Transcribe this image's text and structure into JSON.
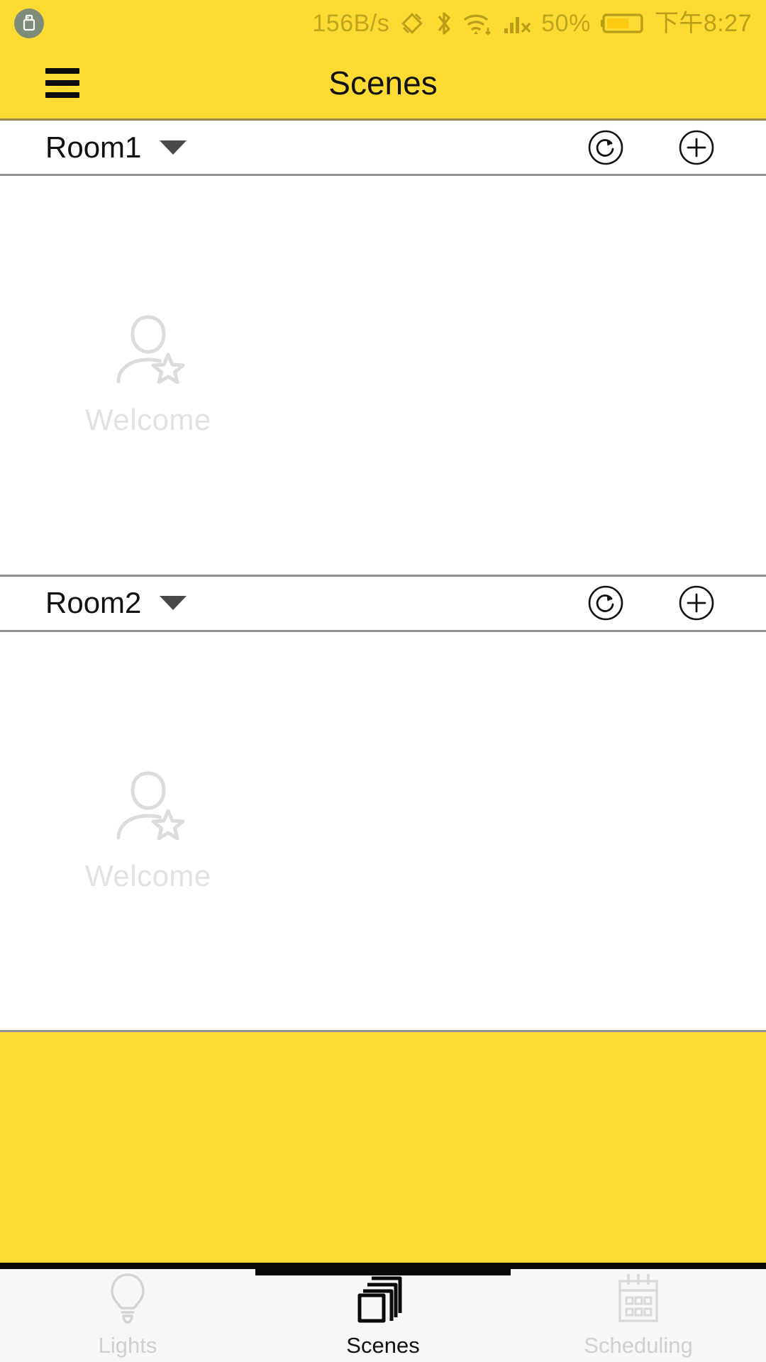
{
  "status_bar": {
    "left_icon": "usb-icon",
    "network_speed": "156B/s",
    "icons": [
      "screen-rotation-icon",
      "bluetooth-icon",
      "wifi-icon",
      "cellular-signal-no-service-icon"
    ],
    "battery_percent": "50%",
    "battery_icon": "battery-icon",
    "time": "下午8:27"
  },
  "header": {
    "menu_icon": "hamburger-menu-icon",
    "title": "Scenes"
  },
  "rooms": [
    {
      "name": "Room1",
      "dropdown_icon": "chevron-down-icon",
      "refresh_icon": "refresh-icon",
      "add_icon": "plus-circle-icon",
      "placeholder_icon": "user-star-icon",
      "placeholder_label": "Welcome"
    },
    {
      "name": "Room2",
      "dropdown_icon": "chevron-down-icon",
      "refresh_icon": "refresh-icon",
      "add_icon": "plus-circle-icon",
      "placeholder_icon": "user-star-icon",
      "placeholder_label": "Welcome"
    }
  ],
  "tabs": [
    {
      "label": "Lights",
      "icon": "lightbulb-icon",
      "active": false
    },
    {
      "label": "Scenes",
      "icon": "stacked-cards-icon",
      "active": true
    },
    {
      "label": "Scheduling",
      "icon": "calendar-icon",
      "active": false
    }
  ],
  "colors": {
    "accent_yellow": "#FDDB33",
    "status_text": "#b99f17",
    "placeholder_gray": "#e2e2e2",
    "divider": "#8d8d8d",
    "tab_inactive": "#cfcfcf",
    "tab_active": "#111111"
  }
}
